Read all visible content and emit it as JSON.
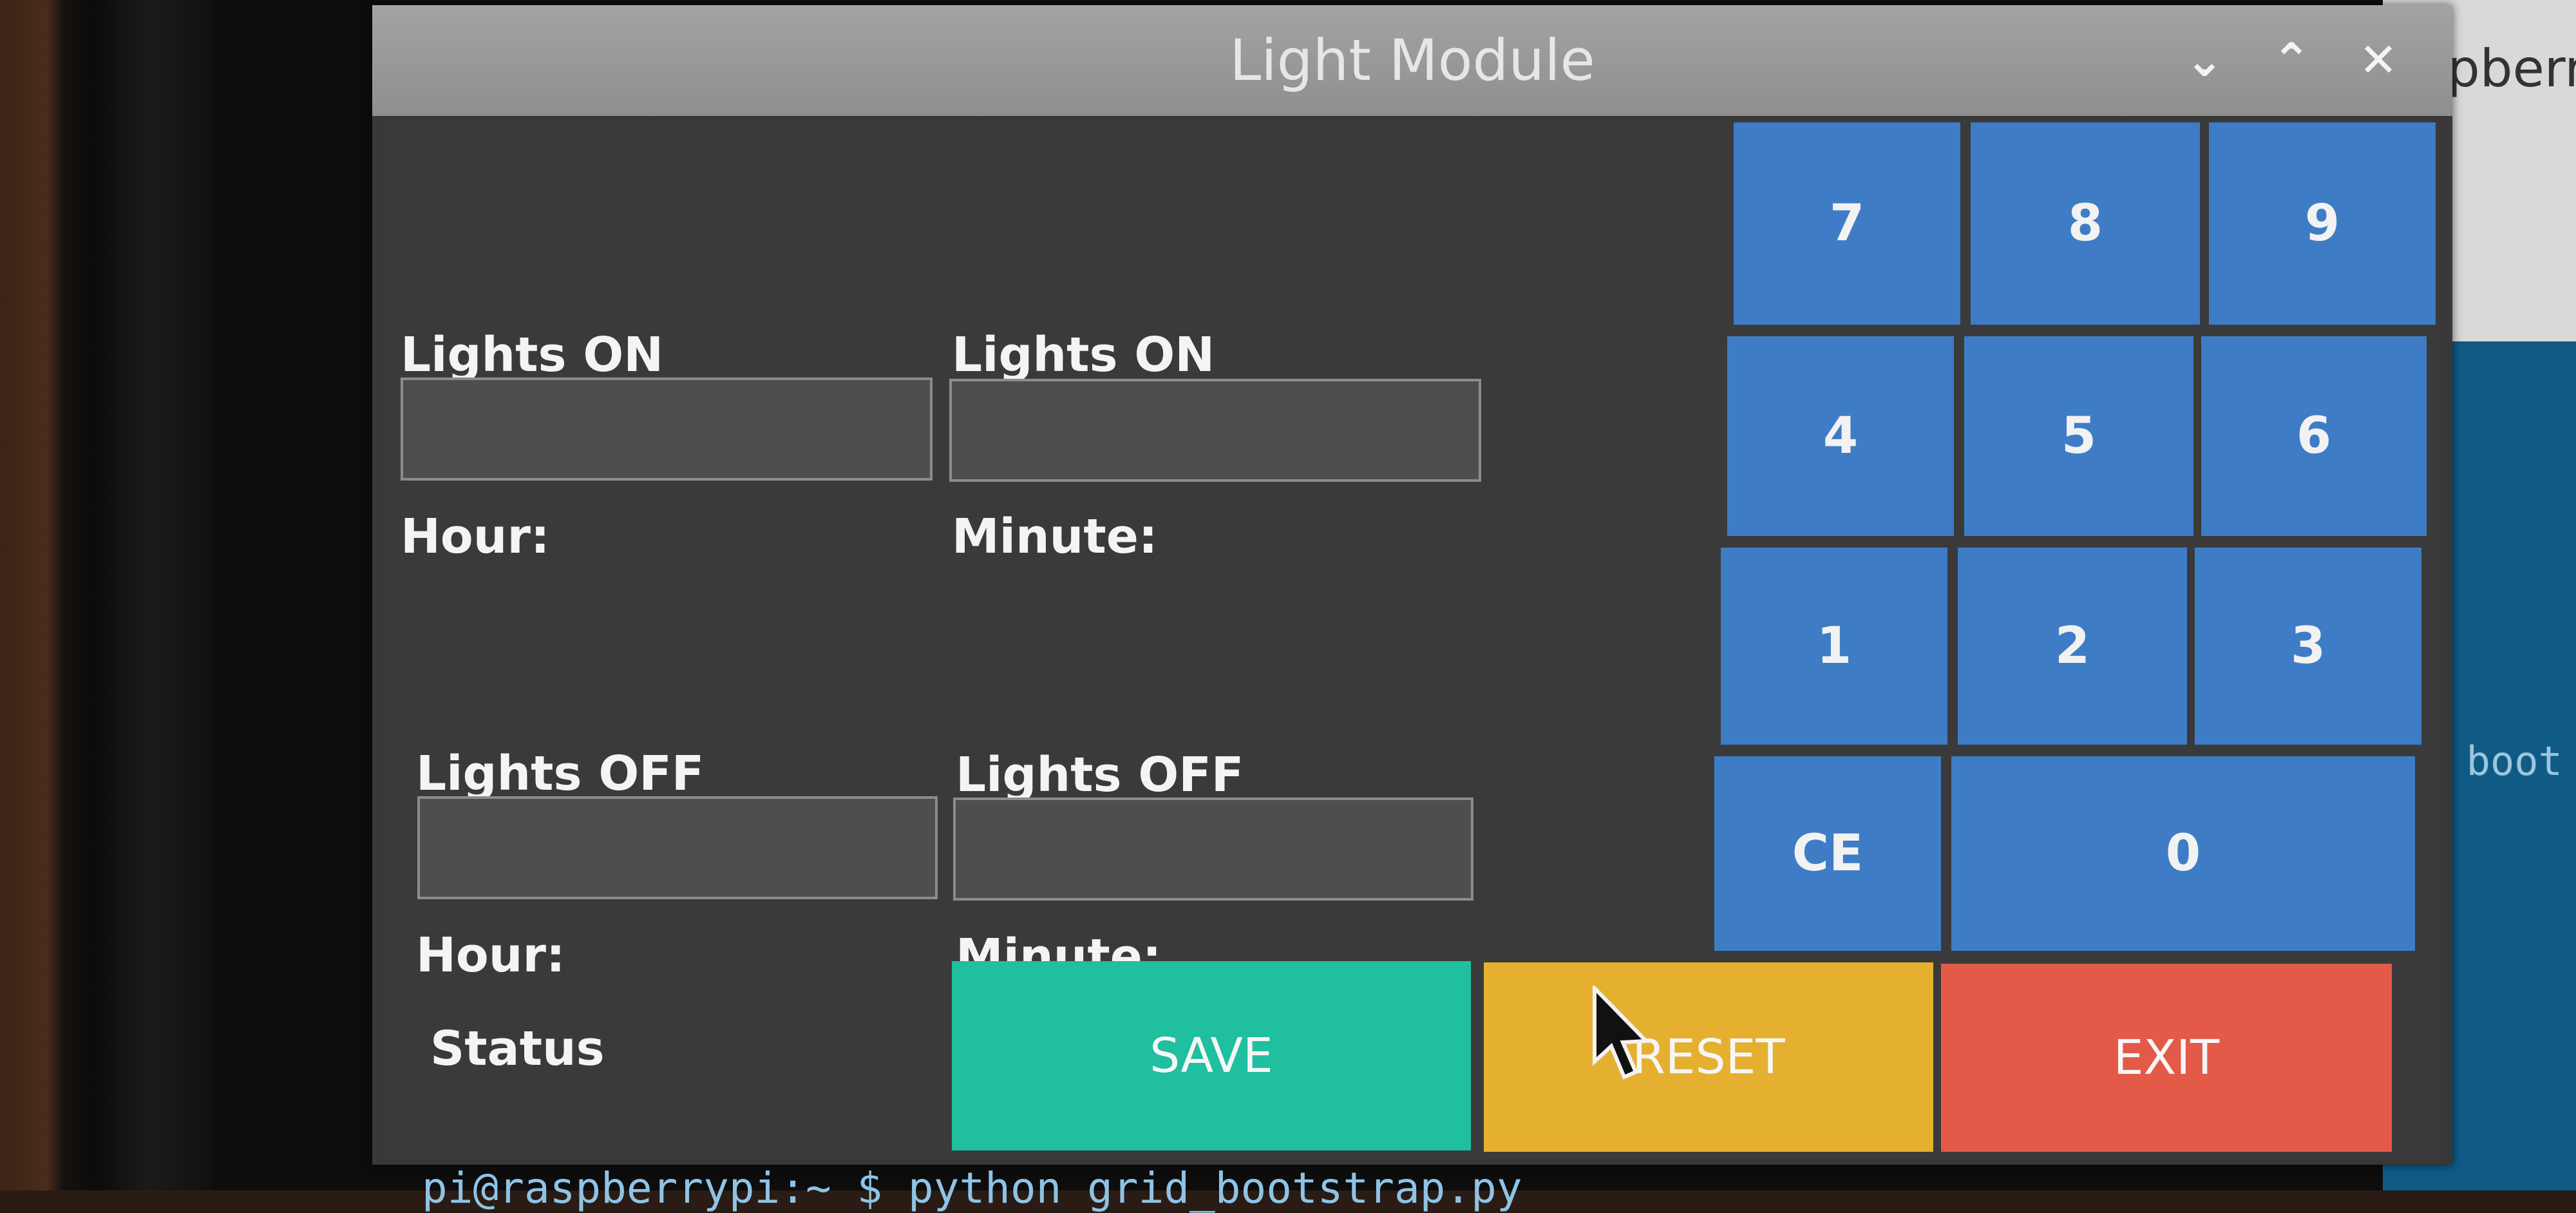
{
  "window": {
    "title": "Light Module",
    "controls": {
      "minimize": "⌄",
      "maximize": "⌃",
      "close": "✕"
    }
  },
  "background": {
    "top_right_text": "pberr",
    "right_text": ", boot",
    "bottom_text": "pi@raspberrypi:~ $ python grid_bootstrap.py"
  },
  "form": {
    "on_hour_label_1": "Lights ON",
    "on_hour_label_2": "Hour:",
    "on_minute_label_1": "Lights ON",
    "on_minute_label_2": "Minute:",
    "off_hour_label_1": "Lights OFF",
    "off_hour_label_2": "Hour:",
    "off_minute_label_1": "Lights OFF",
    "off_minute_label_2": "Minute:",
    "on_hour_value": "",
    "on_minute_value": "",
    "off_hour_value": "",
    "off_minute_value": "",
    "status_label": "Status"
  },
  "keypad": {
    "k7": "7",
    "k8": "8",
    "k9": "9",
    "k4": "4",
    "k5": "5",
    "k6": "6",
    "k1": "1",
    "k2": "2",
    "k3": "3",
    "ce": "CE",
    "k0": "0"
  },
  "actions": {
    "save": "SAVE",
    "reset": "RESET",
    "exit": "EXIT"
  },
  "colors": {
    "keypad": "#3e7dc6",
    "save": "#1fbf9f",
    "reset": "#e5b02f",
    "exit": "#e45a48"
  }
}
